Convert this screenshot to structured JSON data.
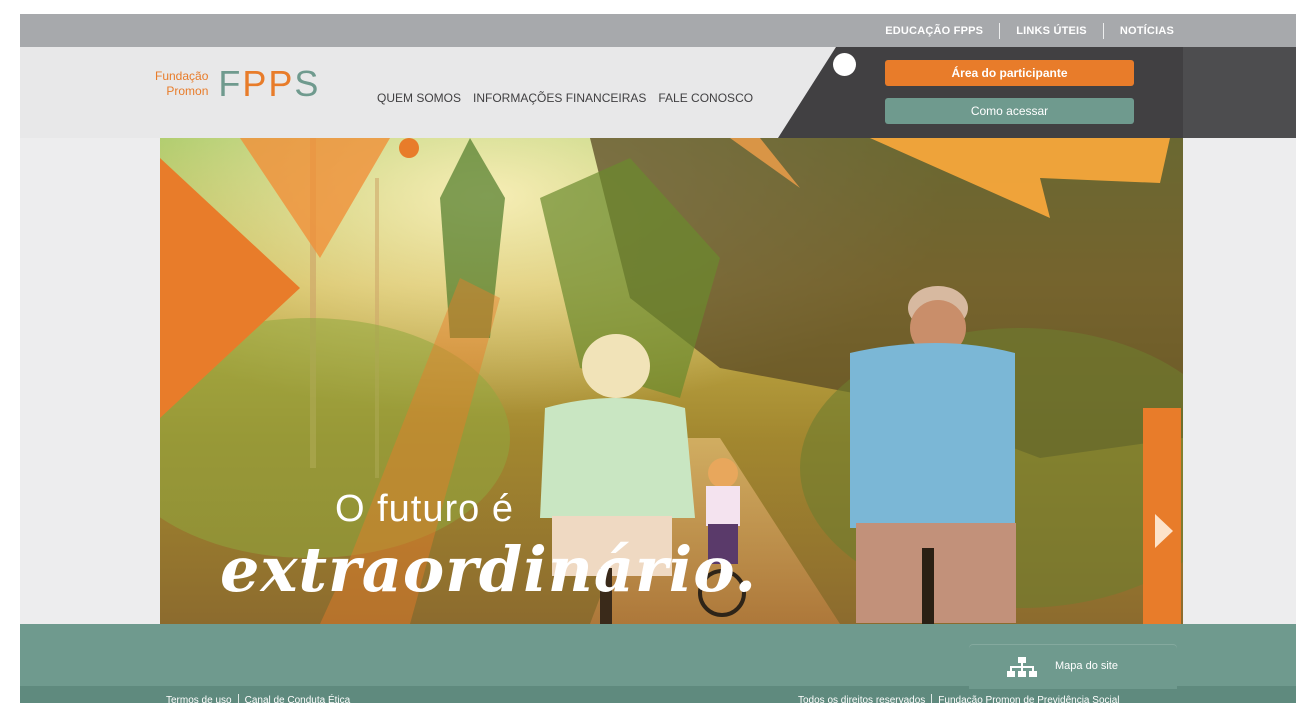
{
  "topbar": {
    "links": [
      "EDUCAÇÃO FPPS",
      "LINKS ÚTEIS",
      "NOTÍCIAS"
    ]
  },
  "logo": {
    "line1": "Fundação",
    "line2": "Promon",
    "letter1": "F",
    "letter2": "P",
    "letter3": "P",
    "letter4": "S"
  },
  "mainnav": {
    "items": [
      "QUEM SOMOS",
      "INFORMAÇÕES FINANCEIRAS",
      "FALE CONOSCO"
    ]
  },
  "buttons": {
    "participant": "Área do participante",
    "access": "Como acessar"
  },
  "hero": {
    "line1": "O futuro é",
    "line2": "extraordinário."
  },
  "footer": {
    "sitemap_label": "Mapa do site",
    "left_links": [
      "Termos de uso",
      "Canal de Conduta Ética"
    ],
    "right_texts": [
      "Todos os direitos reservados",
      "Fundação Promon de Previdência Social"
    ]
  },
  "colors": {
    "orange": "#e87c2a",
    "teal": "#6f9a8e",
    "dark": "#414042",
    "gray": "#a7a9ac"
  },
  "icons": {
    "next": "chevron-right-icon",
    "sitemap": "sitemap-icon"
  }
}
